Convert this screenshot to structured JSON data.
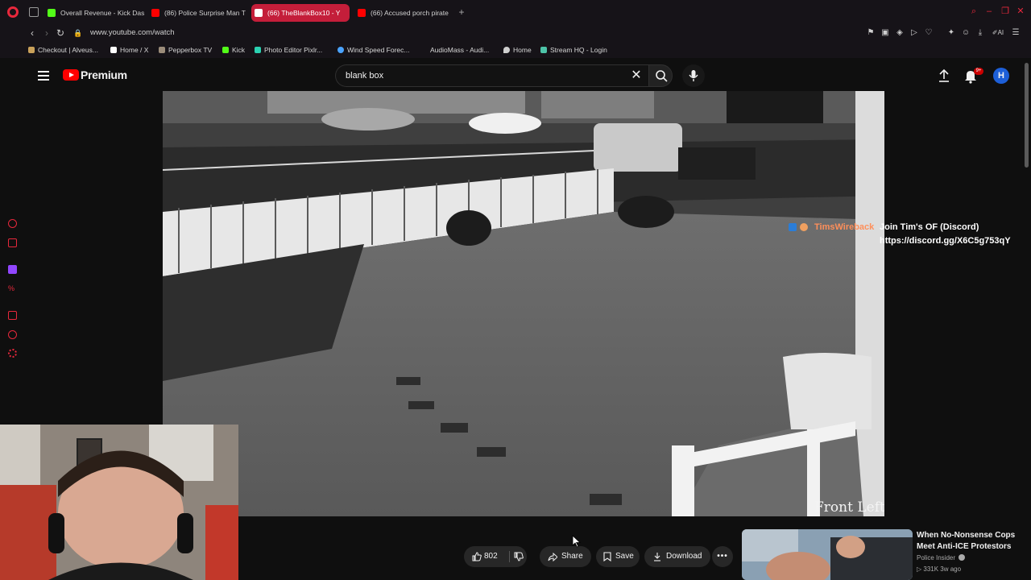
{
  "browser": {
    "tabs": [
      {
        "label": "Overall Revenue - Kick Das",
        "favicon_color": "#53fc18"
      },
      {
        "label": "(86) Police Surprise Man T",
        "favicon_color": "#ff0000"
      },
      {
        "label": "(66) TheBlankBox10 - Y",
        "favicon_color": "#ffffff",
        "active": true
      },
      {
        "label": "(66) Accused porch pirate",
        "favicon_color": "#ff0000"
      }
    ],
    "url": "www.youtube.com/watch",
    "bookmarks": [
      {
        "label": "Checkout | Alveus...",
        "color": "#c9a15a"
      },
      {
        "label": "Home / X",
        "color": "#ffffff"
      },
      {
        "label": "Pepperbox TV",
        "color": "#9b8c7a"
      },
      {
        "label": "Kick",
        "color": "#53fc18"
      },
      {
        "label": "Photo Editor Pixlr...",
        "color": "#2bd1b1"
      },
      {
        "label": "Wind Speed Forec...",
        "color": "#4aa3ff"
      },
      {
        "label": "AudioMass - Audi...",
        "color": "#161318"
      },
      {
        "label": "Home",
        "color": "#cfcfcf"
      },
      {
        "label": "Stream HQ - Login",
        "color": "#4dc3a8"
      }
    ]
  },
  "youtube": {
    "logo_text": "Premium",
    "search_value": "blank box",
    "notification_badge": "9+",
    "avatar_initial": "H"
  },
  "video": {
    "overlay_user": "TimsWireback",
    "overlay_message": "Join Tim's OF (Discord)",
    "overlay_link": "https://discord.gg/X6C5g753qY",
    "camera_label": "Front Left"
  },
  "actions": {
    "like_count": "802",
    "share_label": "Share",
    "save_label": "Save",
    "download_label": "Download"
  },
  "recommended": {
    "title": "When No-Nonsense Cops Meet Anti-ICE Protestors",
    "channel": "Police Insider",
    "meta": "331K  3w ago"
  }
}
